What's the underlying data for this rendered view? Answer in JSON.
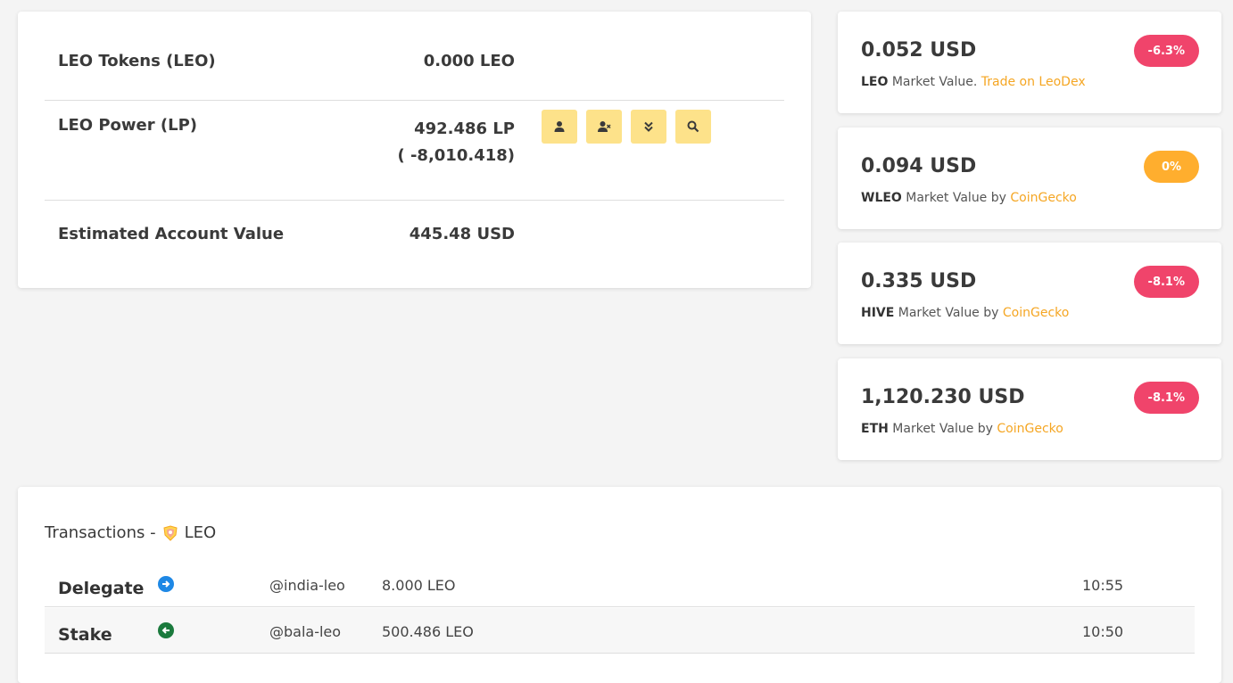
{
  "account": {
    "rows": [
      {
        "label": "LEO Tokens (LEO)",
        "value": "0.000 LEO"
      },
      {
        "label": "LEO Power (LP)",
        "value": "492.486 LP",
        "value2": "( -8,010.418)"
      },
      {
        "label": "Estimated Account Value",
        "value": "445.48 USD"
      }
    ],
    "actions": [
      {
        "icon": "user-icon"
      },
      {
        "icon": "user-remove-icon"
      },
      {
        "icon": "chevrons-down-icon"
      },
      {
        "icon": "search-icon"
      }
    ]
  },
  "markets": [
    {
      "price": "0.052 USD",
      "token": "LEO",
      "text": " Market Value. ",
      "link": "Trade on LeoDex",
      "change": "-6.3%",
      "color": "#f0446b"
    },
    {
      "price": "0.094 USD",
      "token": "WLEO",
      "text": " Market Value by ",
      "link": "CoinGecko",
      "change": "0%",
      "color": "#ffae2e"
    },
    {
      "price": "0.335 USD",
      "token": "HIVE",
      "text": " Market Value by ",
      "link": "CoinGecko",
      "change": "-8.1%",
      "color": "#f0446b"
    },
    {
      "price": "1,120.230 USD",
      "token": "ETH",
      "text": " Market Value by ",
      "link": "CoinGecko",
      "change": "-8.1%",
      "color": "#f0446b"
    }
  ],
  "transactions": {
    "title": "Transactions -",
    "token": "LEO",
    "rows": [
      {
        "type": "Delegate",
        "icon": "arrow-right-icon",
        "iconColor": "#1e88e5",
        "user": "@india-leo",
        "amount": "8.000 LEO",
        "time": "10:55"
      },
      {
        "type": "Stake",
        "icon": "arrow-left-icon",
        "iconColor": "#1b7a3d",
        "user": "@bala-leo",
        "amount": "500.486 LEO",
        "time": "10:50"
      }
    ]
  }
}
